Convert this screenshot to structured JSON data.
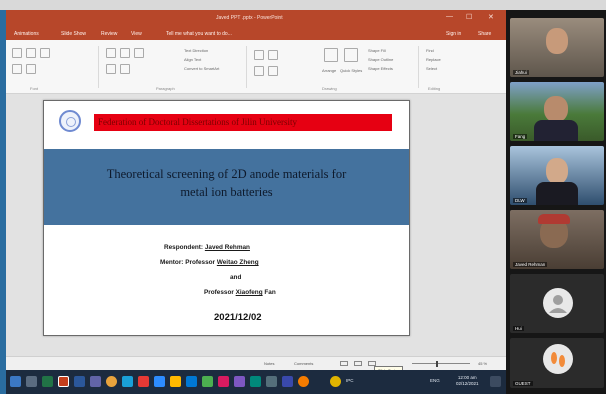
{
  "window": {
    "title": "Javed PPT .pptx - PowerPoint",
    "min": "—",
    "max": "☐",
    "close": "✕"
  },
  "ribbon_tabs": [
    "Animations",
    "Slide Show",
    "Review",
    "View",
    "Tell me what you want to do...",
    "Sign in",
    "Share"
  ],
  "ribbon": {
    "groups": [
      "Font",
      "Paragraph",
      "Drawing",
      "Editing"
    ],
    "buttons": [
      "Text Direction",
      "Align Text",
      "Convert to SmartArt",
      "Arrange",
      "Quick Styles",
      "Shape Fill",
      "Shape Outline",
      "Shape Effects",
      "Find",
      "Replace",
      "Select"
    ]
  },
  "slide": {
    "header": "Federation of Doctoral Dissertations of Jilin University",
    "title_line1": "Theoretical screening of 2D anode materials for",
    "title_line2": "metal ion batteries",
    "respondent_label": "Respondent:",
    "respondent_name": "Javed Rehman",
    "mentor_label": "Mentor: Professor",
    "mentor_name": "Weitao Zheng",
    "and": "and",
    "prof2_label": "Professor",
    "prof2_name": "Xiaofeng",
    "prof2_surname": "Fan",
    "date": "2021/12/02"
  },
  "statusbar": {
    "left": "Notes",
    "comments": "Comments",
    "tooltip": "Slide Sorter",
    "zoom": "45 %"
  },
  "taskbar": {
    "tray_text": "IPC",
    "lang": "ENG",
    "time": "12:00 am",
    "date": "02/12/2021"
  },
  "participants": [
    {
      "name": "Jiahui",
      "color": "#8a7a6a"
    },
    {
      "name": "Fang",
      "color": "#4f7a3a"
    },
    {
      "name": "DLW",
      "color": "#2f4e6e"
    },
    {
      "name": "Javed Rehman",
      "color": "#6a5a4c"
    },
    {
      "name": "Hui",
      "color": "#2b2b2b"
    },
    {
      "name": "GUEST",
      "color": "#2b2b2b"
    }
  ]
}
